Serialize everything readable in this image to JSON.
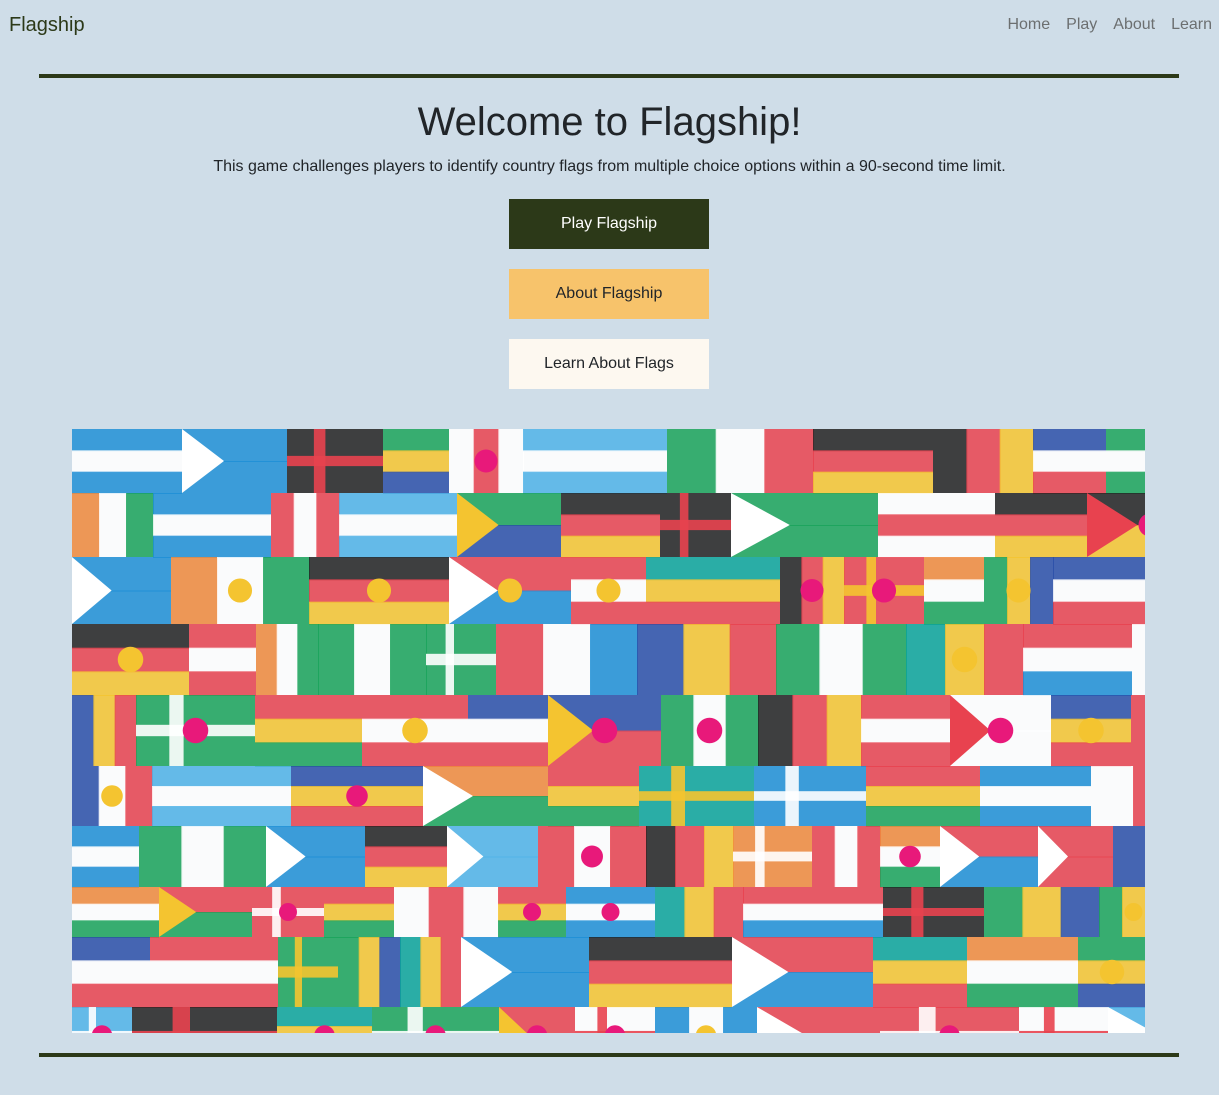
{
  "navbar": {
    "brand": "Flagship",
    "links": [
      "Home",
      "Play",
      "About",
      "Learn"
    ]
  },
  "hero": {
    "title": "Welcome to Flagship!",
    "subtitle": "This game challenges players to identify country flags from multiple choice options within a 90-second time limit."
  },
  "buttons": {
    "play": "Play Flagship",
    "about": "About Flagship",
    "learn": "Learn About Flags"
  },
  "colors": {
    "background": "#cfdde8",
    "primary_dark": "#2c3918",
    "accent_orange": "#f7c36b",
    "cream": "#fdf8f0"
  },
  "image": {
    "icon": "world-flags-collage"
  }
}
